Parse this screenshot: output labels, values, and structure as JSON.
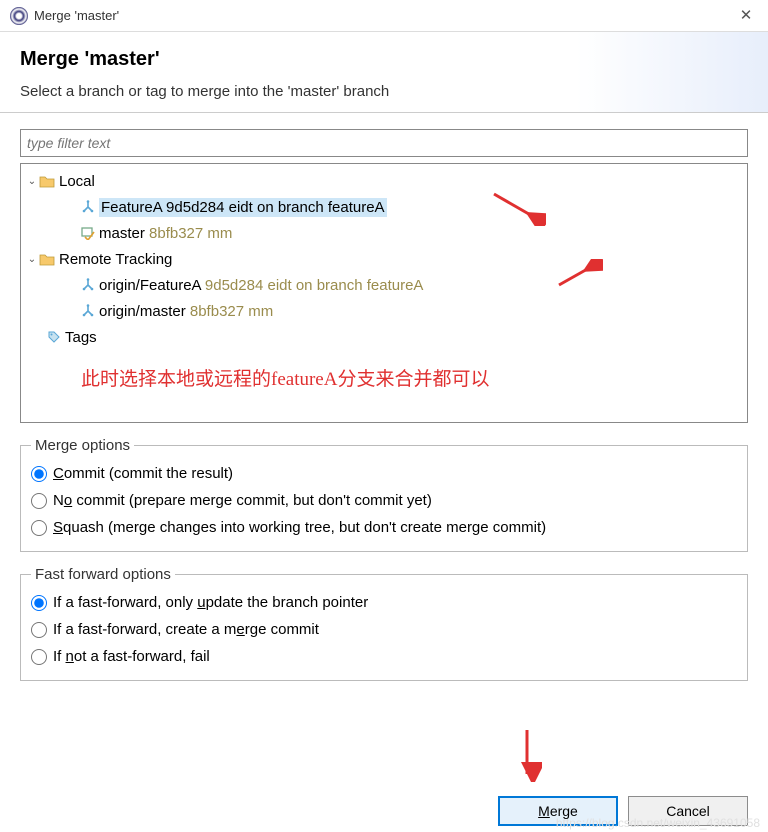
{
  "window": {
    "title": "Merge 'master'"
  },
  "header": {
    "title": "Merge 'master'",
    "subtitle": "Select a branch or tag to merge into the 'master' branch"
  },
  "filter": {
    "placeholder": "type filter text"
  },
  "tree": {
    "local_label": "Local",
    "featureA_name": "FeatureA",
    "featureA_hash": "9d5d284",
    "featureA_msg": "eidt on branch featureA",
    "master_name": "master",
    "master_hash": "8bfb327",
    "master_msg": "mm",
    "remote_label": "Remote Tracking",
    "origin_featureA_name": "origin/FeatureA",
    "origin_master_name": "origin/master",
    "tags_label": "Tags"
  },
  "annotation": "此时选择本地或远程的featureA分支来合并都可以",
  "merge_options": {
    "legend": "Merge options",
    "commit": "ommit (commit the result)",
    "no_commit": "o commit (prepare merge commit, but don't commit yet)",
    "squash": "quash (merge changes into working tree, but don't create merge commit)"
  },
  "ff_options": {
    "legend": "Fast forward options",
    "update": "pdate the branch pointer",
    "update_pre": "If a fast-forward, only ",
    "merge": "erge commit",
    "merge_pre": "If a fast-forward, create a ",
    "fail_pre": "If ",
    "fail_mid": "ot a fast-forward, fail"
  },
  "buttons": {
    "merge_pre": "",
    "merge": "erge",
    "cancel": "Cancel"
  },
  "watermark": "https://blog.csdn.net/weixin_43691058"
}
